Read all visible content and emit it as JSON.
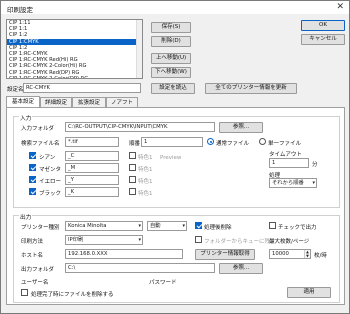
{
  "window": {
    "title": "印刷設定",
    "close_glyph": "✕"
  },
  "list": {
    "items": [
      "CIP 1:11",
      "CIP 1:1",
      "CIP 1:2",
      "CIP 1:CMYK",
      "CIP 1:2",
      "CIP 1:RC-CMYK",
      "CIP 1:RC-CMYK Red(Hi) RG",
      "CIP 1:RC-CMYK 2-Color(Hi) RG",
      "CIP 1:RC-CMYK Red(DP) RG",
      "CIP 1:RC-CMYK 2-Color(DP) RG"
    ],
    "selected_index": 3
  },
  "top_buttons": {
    "save": "保存(S)",
    "delete": "削除(D)",
    "up": "上へ移動(U)",
    "down": "下へ移動(W)",
    "ok": "OK",
    "cancel": "キャンセル"
  },
  "setting_name": {
    "label": "設定名",
    "value": "RC-CMYK",
    "load_button": "設定を読込",
    "printer_info_button": "全てのプリンター情報を更新"
  },
  "tabs": [
    "基本設定",
    "詳細設定",
    "拡張設定",
    "ノアフト"
  ],
  "input_group": {
    "title": "入力",
    "input_folder_label": "入力フォルダ",
    "input_folder_value": "C:\\RC-OUTPUT\\CIP-CMYK\\INPUT\\CMYK",
    "browse": "参照...",
    "target_file_label": "検索ファイル名",
    "target_file_value": "*.tif",
    "sort_label": "順番",
    "sort_value": "1",
    "radio_specific": "通常ファイル",
    "radio_single": "単一ファイル",
    "channels": [
      {
        "label": "シアン",
        "value": "_C",
        "special": "特色1"
      },
      {
        "label": "マゼンタ",
        "value": "_M",
        "special": "特色1"
      },
      {
        "label": "イエロー",
        "value": "_Y",
        "special": "特色1"
      },
      {
        "label": "ブラック",
        "value": "_K",
        "special": "特色1"
      }
    ],
    "preview_label": "Preview",
    "timeout_label": "タイムアウト",
    "timeout_value": "1",
    "timeout_unit": "分",
    "interval_label": "処理",
    "interval_value": "それから順番"
  },
  "output_group": {
    "title": "出力",
    "printer_type_label": "プリンター種別",
    "printer_type_value": "Konica Minolta",
    "auto_value": "自動",
    "auto_delete_label": "処理後削除",
    "preview_label": "チェックで出力",
    "print_mode_label": "印刷方法",
    "print_mode_value": "IP印刷",
    "queue_label": "フォルダーからキューに残す",
    "max_pages_label": "最大枚数/ページ",
    "address_label": "ホスト名",
    "address_value": "192.168.0.XXX",
    "printer_info_button": "プリンター情報取得",
    "max_value": "10000",
    "max_unit": "枚/時",
    "output_folder_label": "出力フォルダ",
    "output_folder_value": "C:\\",
    "user_label": "ユーザー名",
    "password_label": "パスワード",
    "browse": "参照...",
    "retry_label": "処理完了時にファイルを削除する",
    "apply_button": "適用"
  }
}
